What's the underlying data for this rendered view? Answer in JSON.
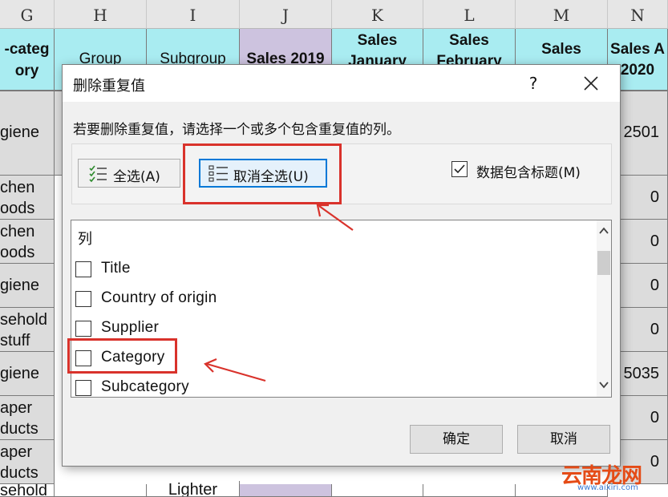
{
  "sheet": {
    "column_letters": [
      "G",
      "H",
      "I",
      "J",
      "K",
      "L",
      "M",
      "N"
    ],
    "headers": [
      "-categ\nory",
      "Group",
      "Subgroup",
      "Sales 2019",
      "Sales\nJanuary",
      "Sales\nFebruary",
      "Sales",
      "Sales A\n2020"
    ],
    "rows": [
      {
        "g": "giene",
        "n": "2501"
      },
      {
        "g": "chen\noods",
        "n": "0"
      },
      {
        "g": "chen\noods",
        "n": "0"
      },
      {
        "g": "giene",
        "n": "0"
      },
      {
        "g": "sehold\nstuff",
        "n": "0"
      },
      {
        "g": "giene",
        "n": "5035"
      },
      {
        "g": "aper\nducts",
        "n": "0"
      },
      {
        "g": "aper\nducts",
        "n": "0"
      },
      {
        "g": "sehold",
        "n": "",
        "i": "Lighter"
      }
    ]
  },
  "dialog": {
    "title": "删除重复值",
    "help": "?",
    "description": "若要删除重复值，请选择一个或多个包含重复值的列。",
    "select_all_label": "全选(A)",
    "deselect_all_label": "取消全选(U)",
    "header_checkbox_label": "数据包含标题(M)",
    "header_checkbox_checked": true,
    "list_header": "列",
    "columns": [
      {
        "label": "Title",
        "checked": false
      },
      {
        "label": "Country of origin",
        "checked": false
      },
      {
        "label": "Supplier",
        "checked": false
      },
      {
        "label": "Category",
        "checked": false
      },
      {
        "label": "Subcategory",
        "checked": false
      }
    ],
    "ok_label": "确定",
    "cancel_label": "取消"
  },
  "watermark": {
    "main": "云南龙网",
    "sub": "www.aixiri.com"
  },
  "colors": {
    "header_cyan": "#a9ecf1",
    "header_purple": "#cdc3df",
    "highlight_red": "#d9322b",
    "focus_blue": "#0078d7"
  }
}
